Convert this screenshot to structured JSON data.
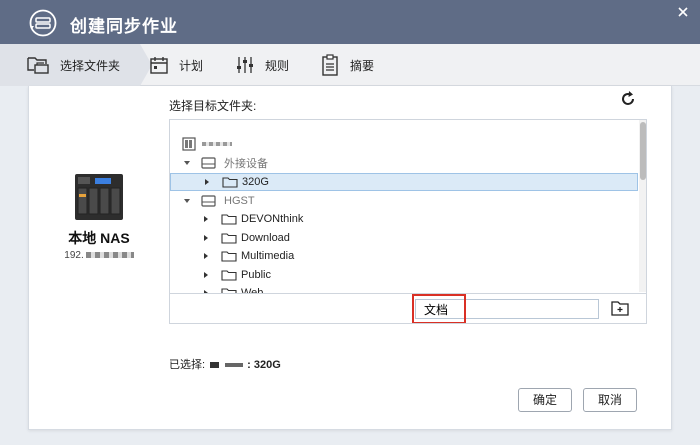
{
  "window": {
    "title": "创建同步作业"
  },
  "steps": [
    {
      "label": "选择文件夹"
    },
    {
      "label": "计划"
    },
    {
      "label": "规则"
    },
    {
      "label": "摘要"
    }
  ],
  "source": {
    "device_name": "本地 NAS",
    "ip_prefix": "192."
  },
  "folder_picker": {
    "heading": "选择目标文件夹:",
    "tree": [
      {
        "label": "",
        "type": "root"
      },
      {
        "label": "外接设备",
        "type": "group"
      },
      {
        "label": "320G",
        "type": "folder",
        "selected": true
      },
      {
        "label": "HGST",
        "type": "group"
      },
      {
        "label": "DEVONthink",
        "type": "folder"
      },
      {
        "label": "Download",
        "type": "folder"
      },
      {
        "label": "Multimedia",
        "type": "folder"
      },
      {
        "label": "Public",
        "type": "folder"
      },
      {
        "label": "Web",
        "type": "folder"
      }
    ],
    "new_folder_name": "文档"
  },
  "selection": {
    "prefix": "已选择: ",
    "suffix": ": 320G"
  },
  "buttons": {
    "ok": "确定",
    "cancel": "取消"
  },
  "colors": {
    "titlebar": "#5f6c86",
    "highlight": "#d93025",
    "selected_row": "#dbeaf7"
  }
}
